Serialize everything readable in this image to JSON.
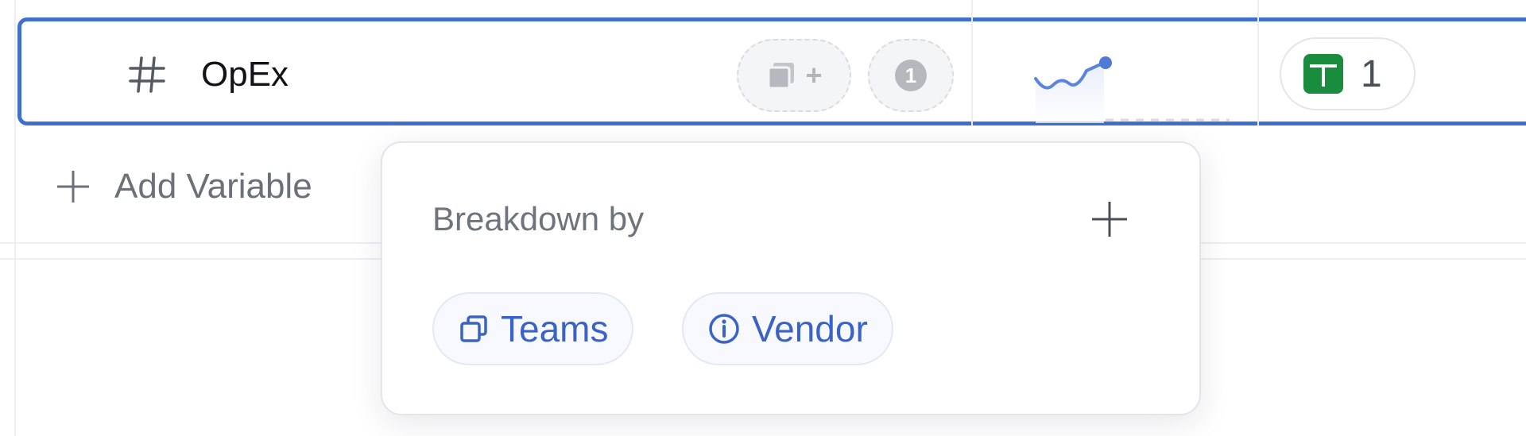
{
  "row": {
    "name": "OpEx",
    "dimension_pill_symbol": "+",
    "info_pill_symbol": "1",
    "source_count": "1"
  },
  "add_variable": {
    "label": "Add Variable"
  },
  "breakdown": {
    "title": "Breakdown by",
    "chips": [
      {
        "label": "Teams",
        "icon": "dimension-icon"
      },
      {
        "label": "Vendor",
        "icon": "info-icon"
      }
    ]
  },
  "colors": {
    "accent": "#3f6fd1",
    "chip_text": "#3a63c6",
    "sheet_green": "#1a8c3e"
  }
}
